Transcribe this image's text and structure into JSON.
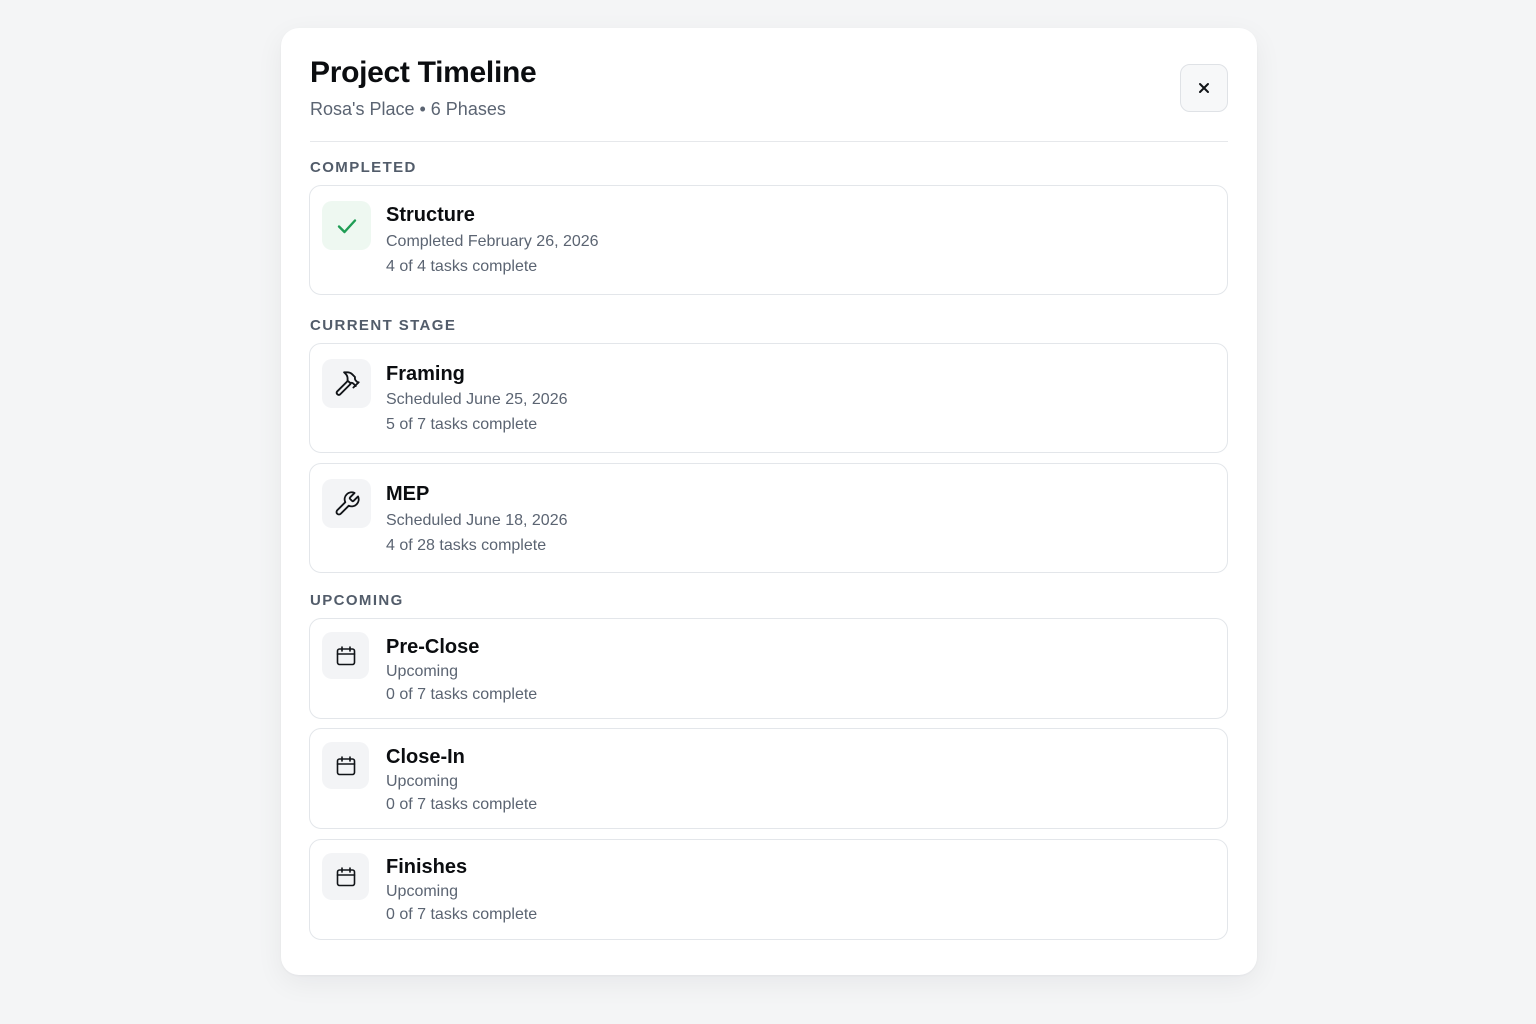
{
  "header": {
    "title": "Project Timeline",
    "subtitle": "Rosa's Place • 6 Phases",
    "close_label": "×"
  },
  "sections": {
    "completed": "COMPLETED",
    "current": "CURRENT STAGE",
    "upcoming": "UPCOMING"
  },
  "phases": [
    {
      "name": "Structure",
      "date": "Completed February 26, 2026",
      "tasks": "4 of 4 tasks complete",
      "icon": "check-icon",
      "status": "completed"
    },
    {
      "name": "Framing",
      "date": "Scheduled June 25, 2026",
      "tasks": "5 of 7 tasks complete",
      "icon": "hammer-icon",
      "status": "current"
    },
    {
      "name": "MEP",
      "date": "Scheduled June 18, 2026",
      "tasks": "4 of 28 tasks complete",
      "icon": "wrench-icon",
      "status": "current"
    },
    {
      "name": "Pre-Close",
      "date": "Upcoming",
      "tasks": "0 of 7 tasks complete",
      "icon": "calendar-icon",
      "status": "upcoming"
    },
    {
      "name": "Close-In",
      "date": "Upcoming",
      "tasks": "0 of 7 tasks complete",
      "icon": "calendar-icon",
      "status": "upcoming"
    },
    {
      "name": "Finishes",
      "date": "Upcoming",
      "tasks": "0 of 7 tasks complete",
      "icon": "calendar-icon",
      "status": "upcoming"
    }
  ],
  "colors": {
    "accent_done": "#1f9d55",
    "text_primary": "#0b0d10",
    "text_secondary": "#5b6472",
    "border": "#e3e6ea"
  }
}
